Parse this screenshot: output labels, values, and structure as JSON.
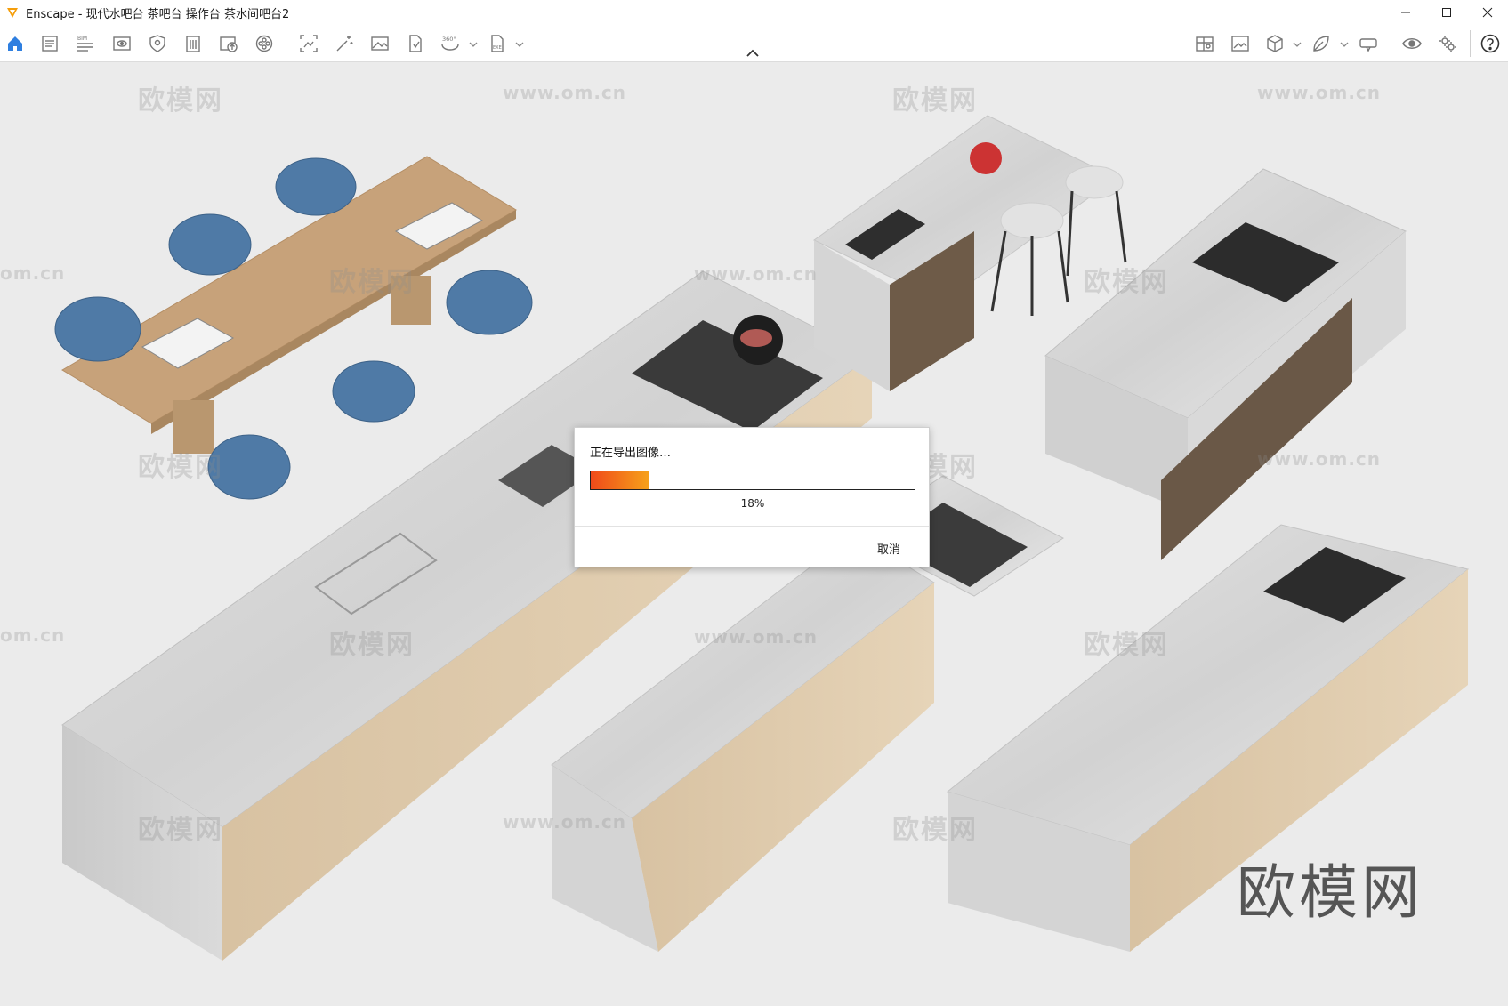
{
  "window": {
    "app_name": "Enscape",
    "title": "Enscape - 现代水吧台 茶吧台 操作台 茶水间吧台2",
    "controls": [
      "minimize",
      "maximize",
      "close"
    ]
  },
  "toolbar": {
    "left_icons": [
      "home-icon",
      "document-icon",
      "bim-icon",
      "view-icon",
      "shield-icon",
      "building-icon",
      "upload-icon",
      "film-reel-icon",
      "capture-frame-icon",
      "magic-wand-icon",
      "image-icon",
      "file-export-icon",
      "panorama-360-icon",
      "exe-export-icon"
    ],
    "bim_label": "BIM",
    "pano_label": "360°",
    "exe_label": "EXE",
    "right_icons": [
      "map-icon",
      "image-library-icon",
      "cube-icon",
      "leaf-icon",
      "vr-headset-icon",
      "eye-icon",
      "settings-icon",
      "help-icon"
    ]
  },
  "viewport": {
    "watermarks": [
      "欧模网",
      "www.om.cn",
      "om.cn"
    ],
    "brand_mark": "欧模网"
  },
  "dialog": {
    "message": "正在导出图像…",
    "progress": 0.18,
    "percent_label": "18%",
    "cancel_label": "取消",
    "colors": {
      "start": "#f04a1a",
      "end": "#f6a21a"
    }
  }
}
